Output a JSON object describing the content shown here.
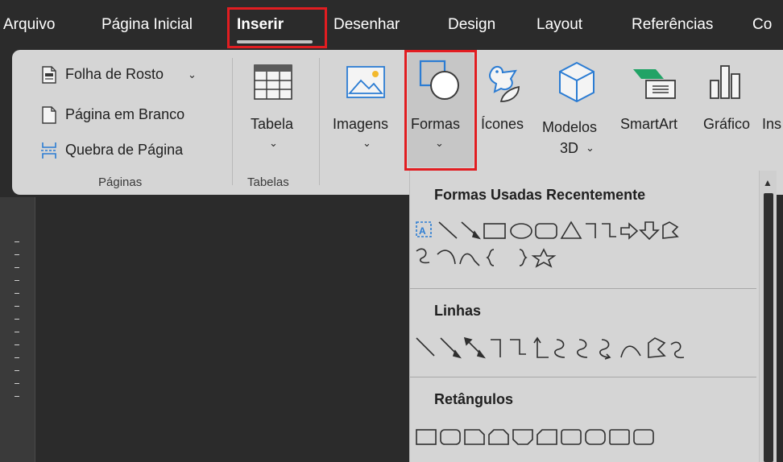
{
  "menu": {
    "items": [
      "Arquivo",
      "Página Inicial",
      "Inserir",
      "Desenhar",
      "Design",
      "Layout",
      "Referências",
      "Co"
    ],
    "active": "Inserir"
  },
  "ribbon": {
    "paginas": {
      "folha_de_rosto": "Folha de Rosto",
      "pagina_em_branco": "Página em Branco",
      "quebra_de_pagina": "Quebra de Página",
      "group_label": "Páginas"
    },
    "tabelas": {
      "tabela": "Tabela",
      "group_label": "Tabelas"
    },
    "ilustracoes": {
      "imagens": "Imagens",
      "formas": "Formas",
      "icones": "Ícones",
      "modelos_3d_line1": "Modelos",
      "modelos_3d_line2": "3D",
      "smartart": "SmartArt",
      "grafico": "Gráfico",
      "cut_label": "Ins"
    }
  },
  "dropdown": {
    "sections": {
      "recent": "Formas Usadas Recentemente",
      "linhas": "Linhas",
      "retangulos": "Retângulos"
    }
  },
  "icons": {
    "folha_de_rosto": "cover-page-icon",
    "pagina_em_branco": "blank-page-icon",
    "quebra_de_pagina": "page-break-icon",
    "tabela": "table-icon",
    "imagens": "picture-icon",
    "formas": "shapes-icon",
    "icones": "icons-icon",
    "modelos_3d": "3d-model-icon",
    "smartart": "smartart-icon",
    "grafico": "chart-icon"
  },
  "colors": {
    "highlight": "#e11d21",
    "background": "#2b2b2b",
    "ribbon": "#d5d5d5",
    "icon_green": "#21a366",
    "icon_blue": "#2b7cd3"
  }
}
